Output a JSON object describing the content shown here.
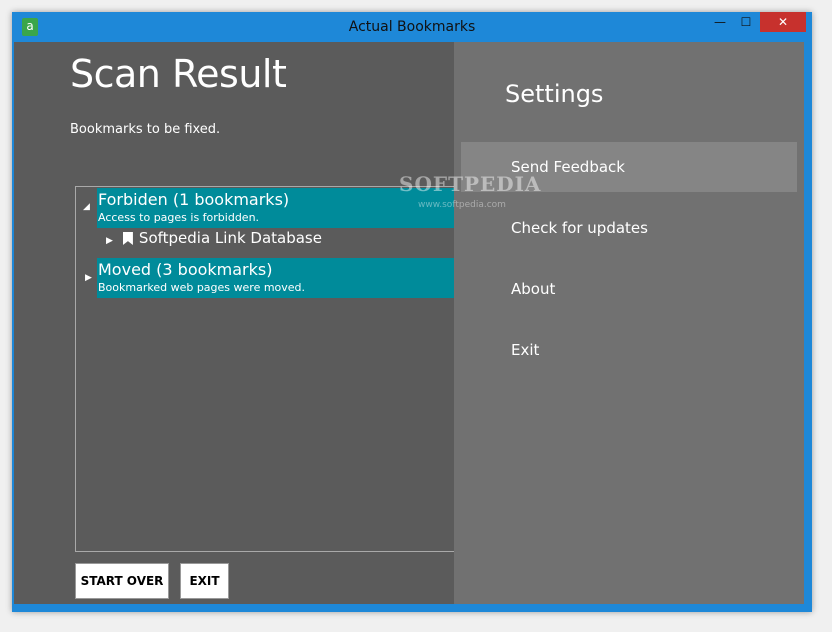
{
  "window": {
    "title": "Actual Bookmarks",
    "app_icon": "a",
    "minimize_glyph": "—",
    "maximize_glyph": "☐",
    "close_glyph": "✕"
  },
  "scan": {
    "title": "Scan Result",
    "subtitle": "Bookmarks to be fixed."
  },
  "tree": {
    "groups": [
      {
        "title": "Forbiden (1 bookmarks)",
        "description": "Access to pages is forbidden.",
        "expanded_glyph": "◢",
        "child": "Softpedia Link Database",
        "child_glyph": "▶"
      },
      {
        "title": "Moved (3 bookmarks)",
        "description": "Bookmarked web pages were moved.",
        "collapsed_glyph": "▶"
      }
    ]
  },
  "buttons": {
    "start_over": "START OVER",
    "exit": "EXIT"
  },
  "settings": {
    "title": "Settings",
    "items": [
      "Send Feedback",
      "Check for updates",
      "About",
      "Exit"
    ]
  },
  "watermark": {
    "text": "SOFTPEDIA",
    "url": "www.softpedia.com"
  },
  "colors": {
    "titlebar": "#1e88d8",
    "client_bg": "#5b5b5b",
    "settings_bg": "#717171",
    "group_highlight": "#008b9a",
    "close_button": "#c7312d"
  }
}
